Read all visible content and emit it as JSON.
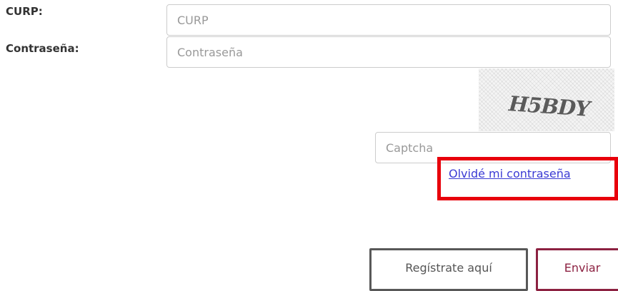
{
  "form": {
    "curp_label": "CURP:",
    "curp_placeholder": "CURP",
    "password_label": "Contraseña:",
    "password_placeholder": "Contraseña",
    "captcha_image_text": "H5BDY",
    "captcha_placeholder": "Captcha",
    "forgot_password_link": "Olvidé mi contraseña"
  },
  "actions": {
    "register_label": "Regístrate aquí",
    "send_label": "Enviar"
  },
  "colors": {
    "send_accent": "#8c2141",
    "link": "#3b3bd4",
    "highlight": "#e8000b"
  }
}
